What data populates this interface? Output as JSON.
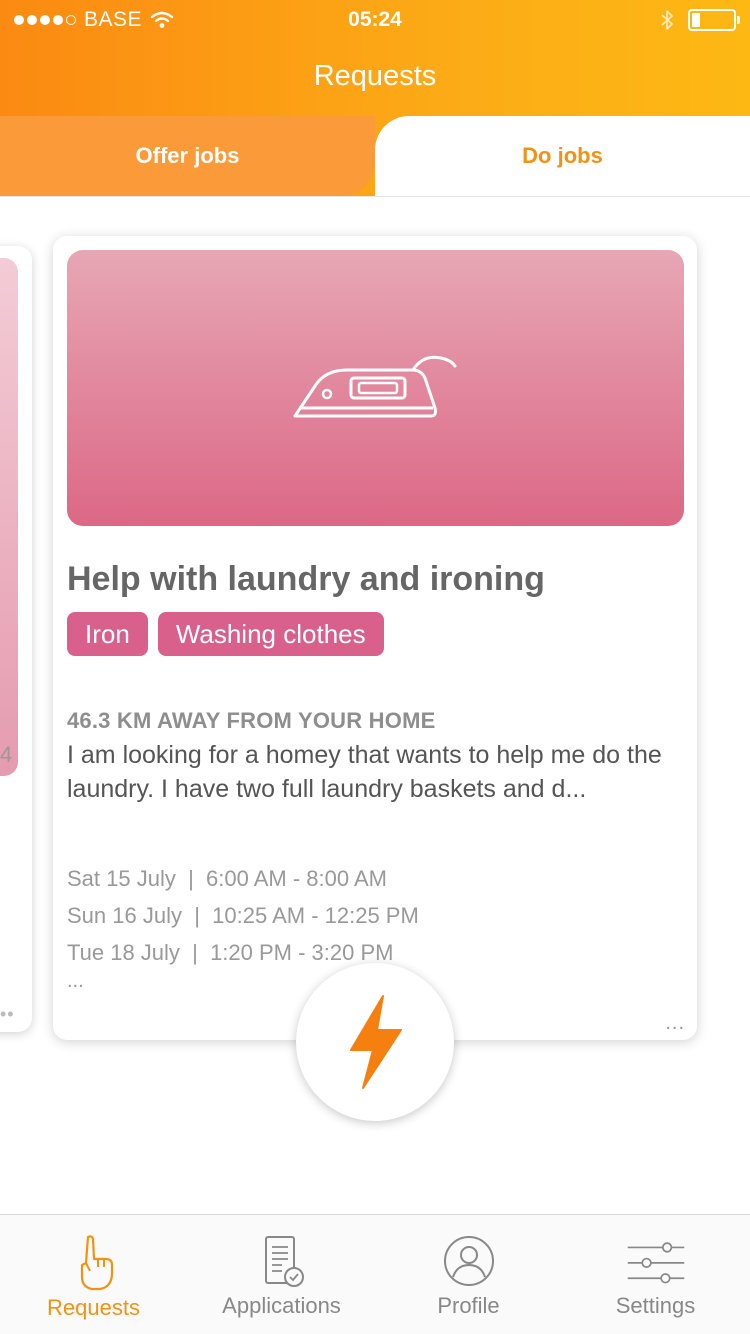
{
  "status_bar": {
    "carrier": "BASE",
    "time": "05:24"
  },
  "nav": {
    "title": "Requests"
  },
  "tabs": {
    "offer_label": "Offer jobs",
    "do_label": "Do jobs",
    "active": "do"
  },
  "peek_card": {
    "partial_text": "4"
  },
  "job_card": {
    "icon": "iron-icon",
    "title": "Help with laundry and ironing",
    "tags": [
      "Iron",
      "Washing clothes"
    ],
    "distance": "46.3 KM AWAY FROM YOUR HOME",
    "description": "I am looking for a homey that wants to help me do the laundry. I have two full laundry baskets and d...",
    "time_slots": [
      "Sat 15 July  |  6:00 AM - 8:00 AM",
      "Sun 16 July  |  10:25 AM - 12:25 PM",
      "Tue 18 July  |  1:20 PM - 3:20 PM"
    ],
    "more_slots": "...",
    "menu": "..."
  },
  "fab": {
    "icon": "lightning-icon"
  },
  "bottom_bar": {
    "items": [
      {
        "label": "Requests",
        "icon": "pointing-hand-icon",
        "active": true
      },
      {
        "label": "Applications",
        "icon": "document-check-icon",
        "active": false
      },
      {
        "label": "Profile",
        "icon": "user-icon",
        "active": false
      },
      {
        "label": "Settings",
        "icon": "sliders-icon",
        "active": false
      }
    ]
  },
  "colors": {
    "brand_orange": "#f39212",
    "card_pink": "#d9608a"
  }
}
